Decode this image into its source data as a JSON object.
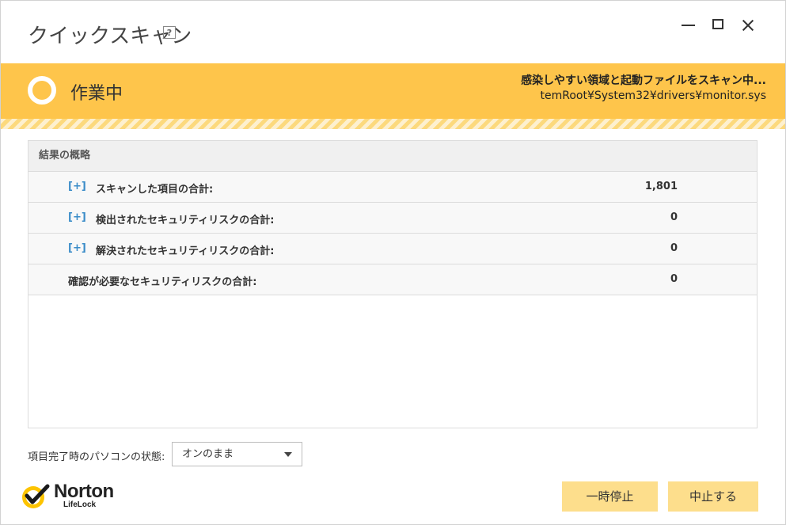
{
  "window": {
    "title": "クイックスキャン",
    "help_label": "?"
  },
  "status": {
    "text": "作業中",
    "scan_title": "感染しやすい領域と起動ファイルをスキャン中...",
    "scan_path": "temRoot¥System32¥drivers¥monitor.sys",
    "accent_color": "#fec54b"
  },
  "results": {
    "header": "結果の概略",
    "rows": [
      {
        "expander": "[+]",
        "label": "スキャンした項目の合計:",
        "value": "1,801"
      },
      {
        "expander": "[+]",
        "label": "検出されたセキュリティリスクの合計:",
        "value": "0"
      },
      {
        "expander": "[+]",
        "label": "解決されたセキュリティリスクの合計:",
        "value": "0"
      },
      {
        "label": "確認が必要なセキュリティリスクの合計:",
        "value": "0"
      }
    ]
  },
  "footer": {
    "pc_state_label": "項目完了時のパソコンの状態:",
    "pc_state_value": "オンのまま",
    "logo_text": "Norton",
    "logo_sub": "LifeLock",
    "pause_button": "一時停止",
    "stop_button": "中止する"
  }
}
